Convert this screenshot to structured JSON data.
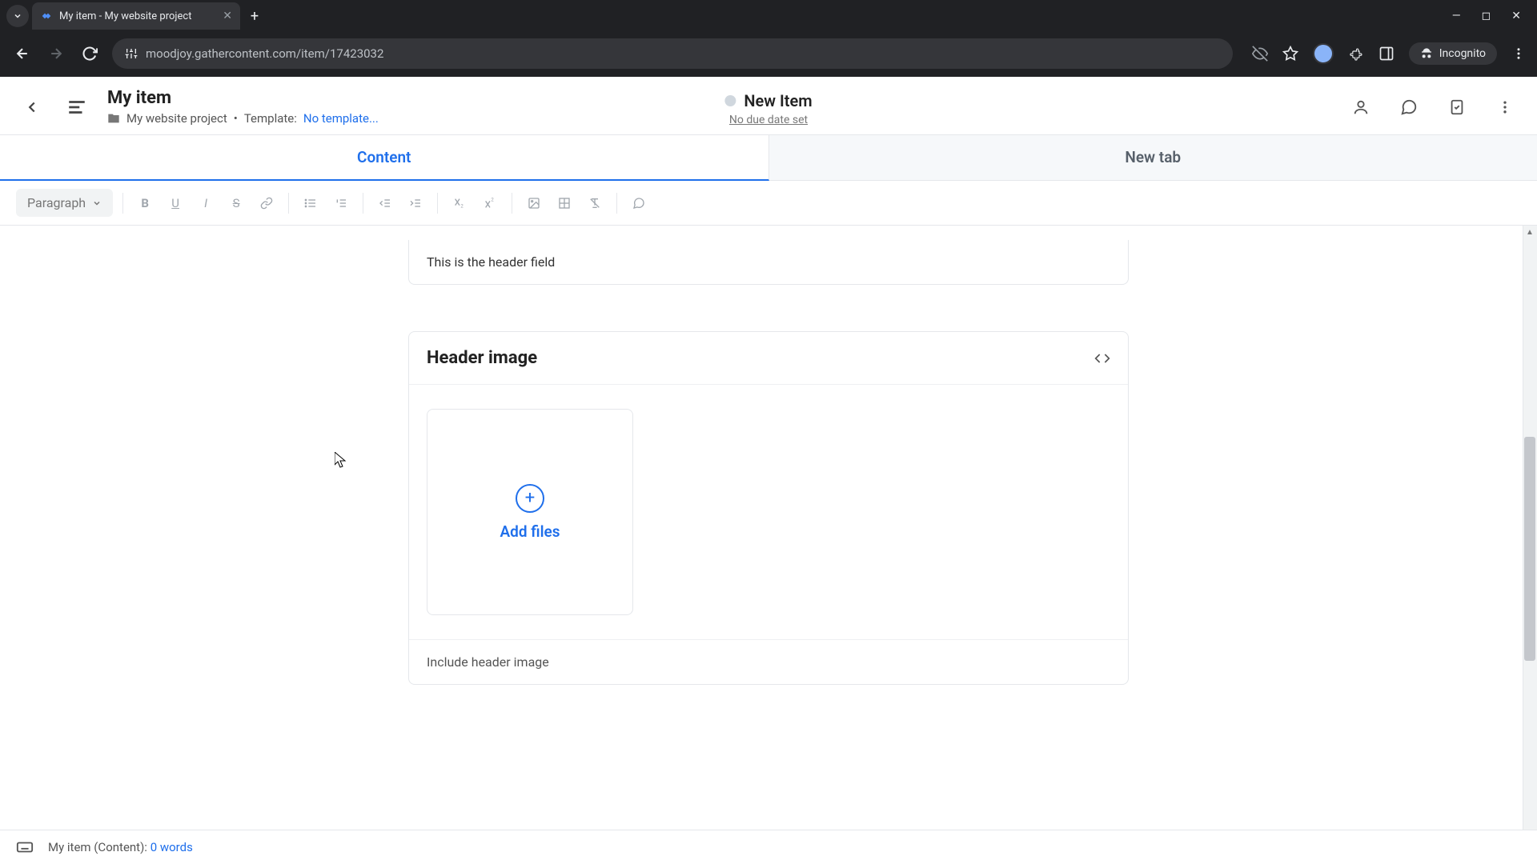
{
  "browser": {
    "tab_title": "My item - My website project",
    "url": "moodjoy.gathercontent.com/item/17423032",
    "incognito_label": "Incognito"
  },
  "header": {
    "title": "My item",
    "project": "My website project",
    "template_prefix": "Template:",
    "template_link": "No template...",
    "status_label": "New Item",
    "due_date": "No due date set"
  },
  "tabs": {
    "content": "Content",
    "new_tab": "New tab"
  },
  "toolbar": {
    "style_select": "Paragraph"
  },
  "fields": {
    "header_text": "This is the header field",
    "header_image": {
      "title": "Header image",
      "add_files": "Add files",
      "hint": "Include header image"
    }
  },
  "statusbar": {
    "context": "My item (Content):",
    "word_count": "0 words"
  }
}
